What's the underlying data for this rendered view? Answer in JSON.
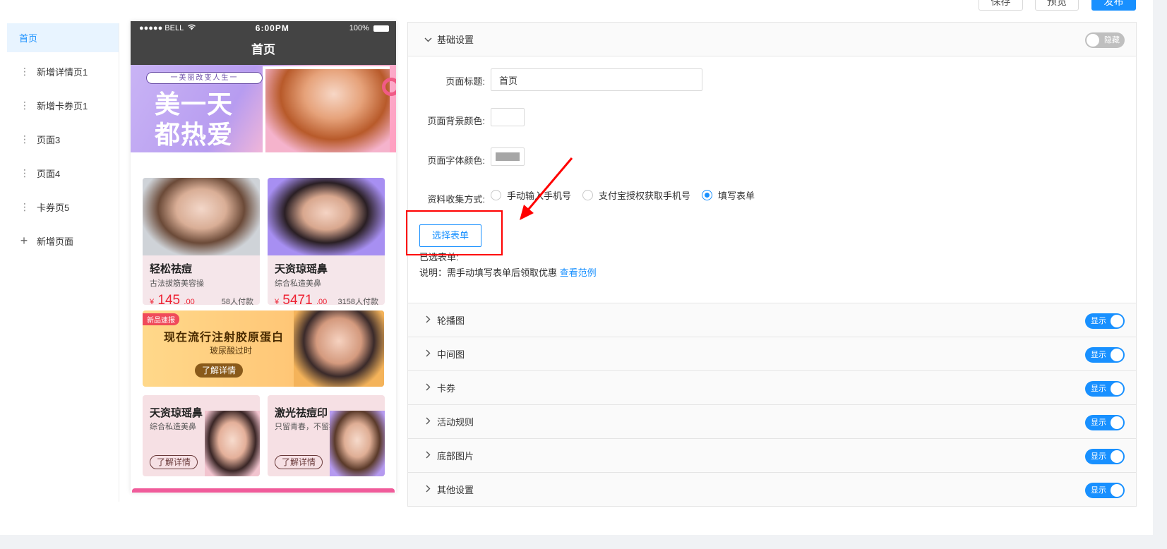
{
  "toolbar": {
    "save_label": "保存",
    "preview_label": "预览",
    "publish_label": "发布"
  },
  "pages": {
    "items": [
      {
        "label": "首页",
        "active": true
      },
      {
        "label": "新增详情页1"
      },
      {
        "label": "新增卡券页1"
      },
      {
        "label": "页面3"
      },
      {
        "label": "页面4"
      },
      {
        "label": "卡券页5"
      }
    ],
    "add_label": "新增页面"
  },
  "phone": {
    "carrier": "●●●●● BELL",
    "time": "6:00PM",
    "battery": "100%",
    "nav_title": "首页",
    "banner": {
      "slogan": "一美丽改变人生一",
      "line1": "美一天",
      "line2": "都热爱"
    },
    "products": [
      {
        "title": "轻松祛痘",
        "subtitle": "古法拔筋美容操",
        "currency": "¥",
        "price_int": "145",
        "price_dec": ".00",
        "paid": "58人付款"
      },
      {
        "title": "天资琼瑶鼻",
        "subtitle": "综合私造美鼻",
        "currency": "¥",
        "price_int": "5471",
        "price_dec": ".00",
        "paid": "3158人付款"
      }
    ],
    "promo": {
      "tag": "新品速报",
      "title": "现在流行注射胶原蛋白",
      "subtitle": "玻尿酸过时",
      "button": "了解详情"
    },
    "minis": [
      {
        "title": "天资琼瑶鼻",
        "subtitle": "综合私造美鼻",
        "button": "了解详情"
      },
      {
        "title": "激光祛痘印",
        "subtitle": "只留青春，不留疤",
        "button": "了解详情"
      }
    ]
  },
  "settings": {
    "basic": {
      "title": "基础设置",
      "toggle_label": "隐藏",
      "page_title_label": "页面标题:",
      "page_title_value": "首页",
      "bg_color_label": "页面背景颜色:",
      "bg_color": "#ffffff",
      "font_color_label": "页面字体颜色:",
      "font_color": "#a6a6a6",
      "collect_label": "资料收集方式:",
      "collect_options": [
        "手动输入手机号",
        "支付宝授权获取手机号",
        "填写表单"
      ],
      "collect_selected": 2,
      "select_form_button": "选择表单",
      "selected_form_label": "已选表单:",
      "note_prefix": "说明：需手动填写表单后领取优惠",
      "note_link": "查看范例"
    },
    "sections": [
      {
        "title": "轮播图",
        "toggle_label": "显示"
      },
      {
        "title": "中间图",
        "toggle_label": "显示"
      },
      {
        "title": "卡券",
        "toggle_label": "显示"
      },
      {
        "title": "活动规则",
        "toggle_label": "显示"
      },
      {
        "title": "底部图片",
        "toggle_label": "显示"
      },
      {
        "title": "其他设置",
        "toggle_label": "显示"
      }
    ]
  },
  "colors": {
    "accent": "#1890ff",
    "annotation": "#ff0000",
    "price": "#ee2233"
  },
  "icons": {
    "expanded": "chevron-down-icon",
    "collapsed": "chevron-right-icon",
    "drag": "drag-handle-icon",
    "add": "plus-icon",
    "wifi": "wifi-icon"
  }
}
